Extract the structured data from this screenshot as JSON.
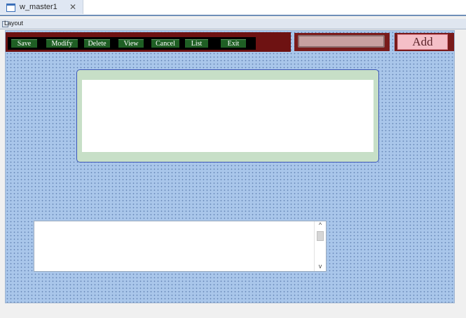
{
  "document_tab": {
    "title": "w_master1",
    "close": "✕"
  },
  "layout_label": "Layout",
  "toolbar": {
    "buttons": [
      "Save",
      "Modify",
      "Delete",
      "View",
      "Cancel",
      "List",
      "Exit"
    ],
    "add_label": "Add"
  },
  "list_box": {
    "scroll_up": "^",
    "scroll_down": "v"
  },
  "colors": {
    "canvas": "#a9c6ea",
    "toolbar": "#6e1212",
    "button": "#1f5f24",
    "add_button": "#f5bfc7",
    "group_frame": "#c7dfc7"
  }
}
